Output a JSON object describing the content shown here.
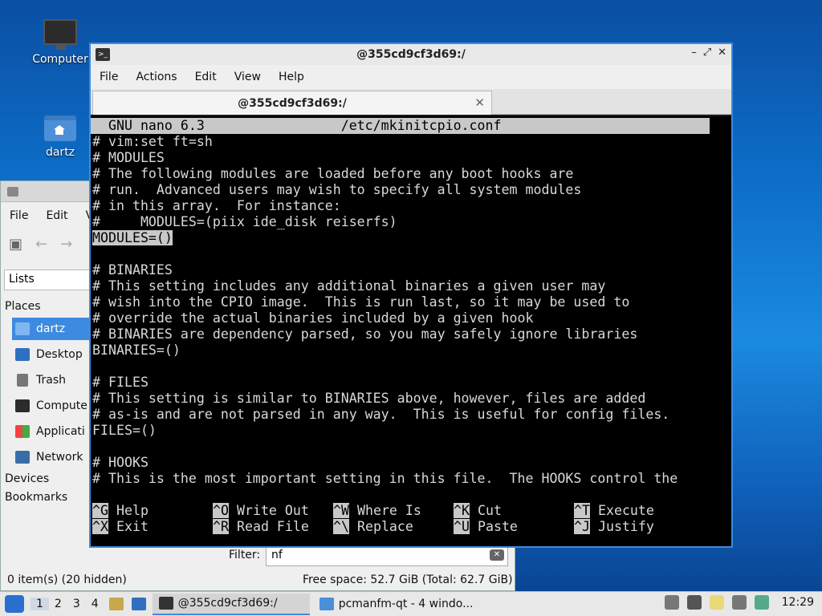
{
  "desktop": {
    "icons": [
      {
        "label": "Computer"
      },
      {
        "label": "dartz"
      }
    ]
  },
  "file_manager": {
    "menu": [
      "File",
      "Edit",
      "V"
    ],
    "lists_label": "Lists",
    "places_heading": "Places",
    "places": [
      {
        "label": "dartz",
        "icon": "home-folder-icon"
      },
      {
        "label": "Desktop",
        "icon": "desktop-icon"
      },
      {
        "label": "Trash",
        "icon": "trash-icon"
      },
      {
        "label": "Compute",
        "icon": "computer-icon"
      },
      {
        "label": "Applicati",
        "icon": "applications-icon"
      },
      {
        "label": "Network",
        "icon": "network-icon"
      }
    ],
    "devices_heading": "Devices",
    "bookmarks_heading": "Bookmarks",
    "filter_label": "Filter:",
    "filter_value": "nf",
    "status_left": "0 item(s) (20 hidden)",
    "status_right": "Free space: 52.7 GiB (Total: 62.7 GiB)"
  },
  "terminal": {
    "title": "@355cd9cf3d69:/",
    "menu": [
      "File",
      "Actions",
      "Edit",
      "View",
      "Help"
    ],
    "tab_label": "@355cd9cf3d69:/",
    "nano_header": "  GNU nano 6.3                 /etc/mkinitcpio.conf",
    "lines": [
      "# vim:set ft=sh",
      "# MODULES",
      "# The following modules are loaded before any boot hooks are",
      "# run.  Advanced users may wish to specify all system modules",
      "# in this array.  For instance:",
      "#     MODULES=(piix ide_disk reiserfs)",
      "MODULES=()",
      "",
      "# BINARIES",
      "# This setting includes any additional binaries a given user may",
      "# wish into the CPIO image.  This is run last, so it may be used to",
      "# override the actual binaries included by a given hook",
      "# BINARIES are dependency parsed, so you may safely ignore libraries",
      "BINARIES=()",
      "",
      "# FILES",
      "# This setting is similar to BINARIES above, however, files are added",
      "# as-is and are not parsed in any way.  This is useful for config files.",
      "FILES=()",
      "",
      "# HOOKS",
      "# This is the most important setting in this file.  The HOOKS control the"
    ],
    "shortcuts_row1": [
      {
        "key": "^G",
        "label": " Help"
      },
      {
        "key": "^O",
        "label": " Write Out"
      },
      {
        "key": "^W",
        "label": " Where Is"
      },
      {
        "key": "^K",
        "label": " Cut"
      },
      {
        "key": "^T",
        "label": " Execute"
      }
    ],
    "shortcuts_row2": [
      {
        "key": "^X",
        "label": " Exit"
      },
      {
        "key": "^R",
        "label": " Read File"
      },
      {
        "key": "^\\",
        "label": " Replace"
      },
      {
        "key": "^U",
        "label": " Paste"
      },
      {
        "key": "^J",
        "label": " Justify"
      }
    ]
  },
  "taskbar": {
    "workspaces": [
      "1",
      "2",
      "3",
      "4"
    ],
    "tasks": [
      {
        "label": "@355cd9cf3d69:/"
      },
      {
        "label": "pcmanfm-qt - 4 windo..."
      }
    ],
    "clock": "12:29"
  }
}
